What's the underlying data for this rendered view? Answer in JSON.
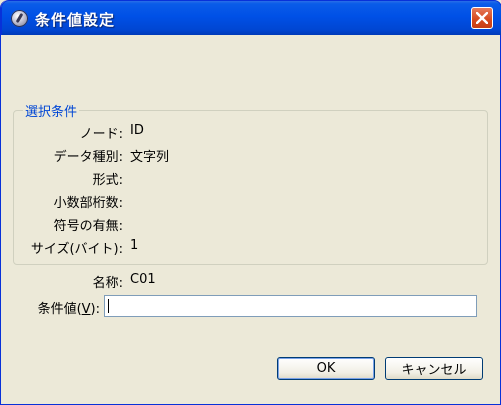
{
  "window": {
    "title": "条件値設定",
    "icon": "app-disc-icon",
    "close_icon": "close-x-icon",
    "colors": {
      "titlebar": "#0050e6",
      "close": "#d6481c",
      "background": "#ece9d8",
      "legend": "#0046d5"
    }
  },
  "group": {
    "legend": "選択条件",
    "rows": [
      {
        "label": "ノード:",
        "value": "ID"
      },
      {
        "label": "データ種別:",
        "value": "文字列"
      },
      {
        "label": "形式:",
        "value": ""
      },
      {
        "label": "小数部桁数:",
        "value": ""
      },
      {
        "label": "符号の有無:",
        "value": ""
      },
      {
        "label": "サイズ(バイト):",
        "value": "1"
      }
    ]
  },
  "name": {
    "label": "名称:",
    "value": "C01"
  },
  "condition": {
    "label_prefix": "条件値(",
    "mnemonic": "V",
    "label_suffix": "):",
    "value": ""
  },
  "buttons": {
    "ok": "OK",
    "cancel": "キャンセル"
  }
}
